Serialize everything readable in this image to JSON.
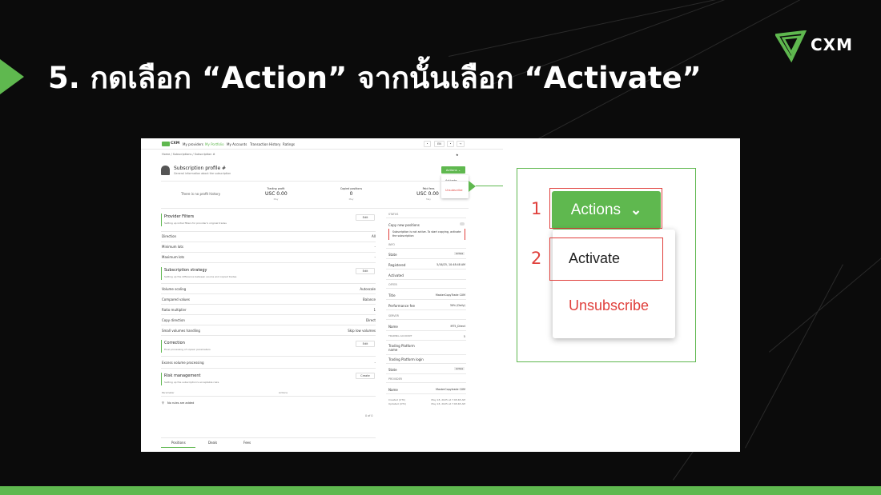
{
  "slide": {
    "title": "5. กดเลือก “Action” จากนั้นเลือก “Activate”",
    "brand": "CXM"
  },
  "colors": {
    "accent": "#5fb84f",
    "danger": "#e0403c",
    "background": "#0b0b0b"
  },
  "app": {
    "nav": {
      "brand": "CXM",
      "items": [
        "My providers",
        "My Portfolio",
        "My Accounts",
        "Transaction History",
        "Ratings"
      ],
      "lang": "EN"
    },
    "breadcrumb": "Home / Subscriptions / Subscription #",
    "profile": {
      "title": "Subscription profile #",
      "subtitle": "General information about the subscription"
    },
    "actions": {
      "button": "Actions",
      "activate": "Activate",
      "unsubscribe": "Unsubscribe"
    },
    "stats": {
      "no_profit": "There is no profit history",
      "trading_profit_label": "Trading profit",
      "trading_profit": "USC 0.00",
      "copied_label": "Copied positions",
      "copied": "0",
      "fees_label": "Paid fees",
      "fees": "USC 0.00",
      "period": "May"
    },
    "sections": {
      "provider_filters": {
        "title": "Provider Filters",
        "sub": "Setting up initial filters for provider's original trades",
        "edit": "Edit"
      },
      "direction": {
        "label": "Direction",
        "value": "All"
      },
      "min_lots": {
        "label": "Minimum lots",
        "value": "-"
      },
      "max_lots": {
        "label": "Maximum lots",
        "value": "-"
      },
      "strategy": {
        "title": "Subscription strategy",
        "sub": "Setting up the difference between source and copied trades",
        "edit": "Edit"
      },
      "volume_scaling": {
        "label": "Volume scaling",
        "value": "Autoscale"
      },
      "compared_values": {
        "label": "Compared values",
        "value": "Balance"
      },
      "ratio": {
        "label": "Ratio multiplier",
        "value": "1"
      },
      "copy_direction": {
        "label": "Copy direction",
        "value": "Direct"
      },
      "small_volumes": {
        "label": "Small volumes handling",
        "value": "Skip low volumes"
      },
      "correction": {
        "title": "Correction",
        "sub": "Final processing of copies' parameters",
        "edit": "Edit"
      },
      "excess": {
        "label": "Excess volume processing",
        "value": "-"
      },
      "risk": {
        "title": "Risk management",
        "sub": "Setting up the subscription's acceptable risks",
        "create": "Create"
      },
      "risk_cols": {
        "param": "Parameter",
        "actions": "Actions"
      },
      "no_rules": "No rules are added",
      "pager": "0 of 0"
    },
    "status": {
      "header": "STATUS",
      "copy_label": "Copy new positions",
      "warning": "Subscription is not active. To start copying, activate the subscription",
      "info": "INFO",
      "state_label": "State",
      "state": "Active",
      "registered_label": "Registered",
      "registered": "5/16/25, 10:48:48 AM",
      "activated_label": "Activated",
      "offer": "OFFER",
      "title_label": "Title",
      "title_value": "MasterCopyTrade CXM",
      "perf_label": "Performance fee",
      "perf_value": "30% (Daily)",
      "server": "SERVER",
      "name_label": "Name",
      "name_value": "MT5_Direct",
      "trading_account": "TRADING ACCOUNT",
      "trading_account_value": "5",
      "platform_name_label": "Trading Platform name",
      "platform_login_label": "Trading Platform login",
      "state2_label": "State",
      "state2": "Active",
      "provider": "PROVIDER",
      "provider_name_label": "Name",
      "provider_name": "MasterCopytrade CXM",
      "created_label": "Created (UTC)",
      "created": "May 18, 2025 at 7:48:48 AM",
      "updated_label": "Updated (UTC)",
      "updated": "May 18, 2025 at 7:48:48 AM"
    },
    "tabs": [
      "Positions",
      "Deals",
      "Fees"
    ]
  },
  "zoom": {
    "step1": "1",
    "step2": "2",
    "actions": "Actions",
    "activate": "Activate",
    "unsubscribe": "Unsubscribe"
  }
}
